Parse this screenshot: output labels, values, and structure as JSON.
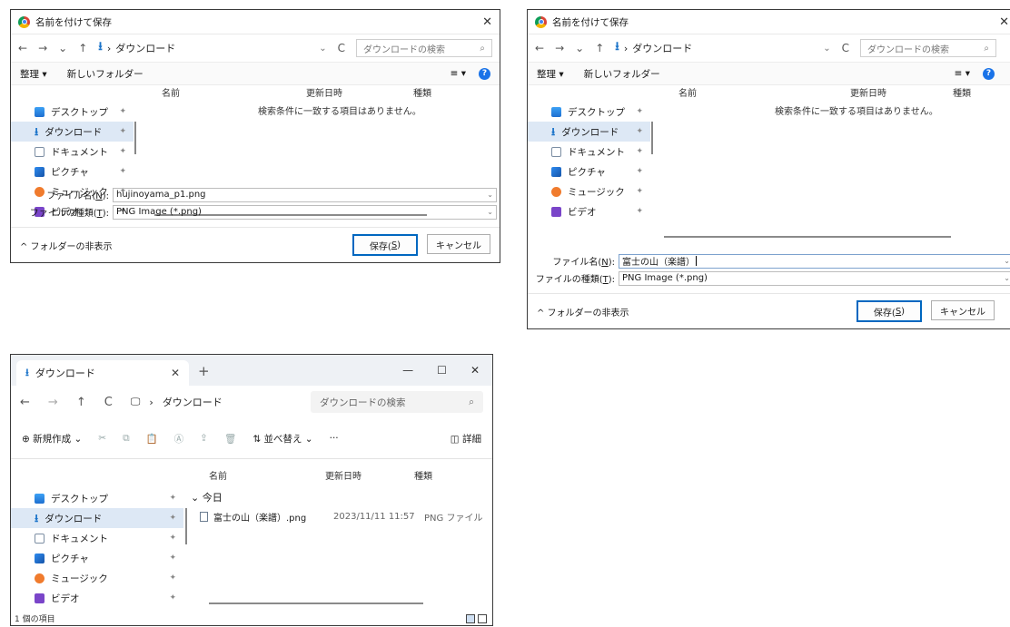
{
  "save_dialog_1": {
    "title": "名前を付けて保存",
    "close": "✕",
    "nav_arrows": [
      "←",
      "→",
      "⌄",
      "↑"
    ],
    "path_icon": "download-arrow",
    "path_sep": "›",
    "path": "ダウンロード",
    "refresh": "C",
    "search_placeholder": "ダウンロードの検索",
    "search_icon": "⌕",
    "organize": "整理 ▾",
    "new_folder": "新しいフォルダー",
    "view_menu": "≡ ▾",
    "help": "?",
    "columns": [
      "名前",
      "更新日時",
      "種類"
    ],
    "empty_message": "検索条件に一致する項目はありません。",
    "sidebar": [
      "デスクトップ",
      "ダウンロード",
      "ドキュメント",
      "ピクチャ",
      "ミュージック",
      "ビデオ"
    ],
    "pin": "📌",
    "filename_label_pre": "ファイル名(",
    "filename_label_key": "N",
    "filename_label_post": "):",
    "filename_value": "hujinoyama_p1.png",
    "filetype_label_pre": "ファイルの種類(",
    "filetype_label_key": "T",
    "filetype_label_post": "):",
    "filetype_value": "PNG Image (*.png)",
    "hide_folders": "^ フォルダーの非表示",
    "save_pre": "保存(",
    "save_key": "S",
    "save_post": ")",
    "cancel": "キャンセル"
  },
  "save_dialog_2": {
    "title": "名前を付けて保存",
    "close": "✕",
    "path": "ダウンロード",
    "search_placeholder": "ダウンロードの検索",
    "organize": "整理 ▾",
    "new_folder": "新しいフォルダー",
    "columns": [
      "名前",
      "更新日時",
      "種類"
    ],
    "empty_message": "検索条件に一致する項目はありません。",
    "sidebar": [
      "デスクトップ",
      "ダウンロード",
      "ドキュメント",
      "ピクチャ",
      "ミュージック",
      "ビデオ"
    ],
    "filename_value": "富士の山（楽譜）",
    "filetype_value": "PNG Image (*.png)",
    "hide_folders": "^ フォルダーの非表示",
    "cancel": "キャンセル"
  },
  "explorer": {
    "tab_title": "ダウンロード",
    "tab_close": "✕",
    "tab_new": "+",
    "min": "—",
    "max": "☐",
    "close": "✕",
    "nav": [
      "←",
      "→",
      "↑",
      "C"
    ],
    "monitor_icon": "🖵",
    "crumb_sep": "›",
    "path": "ダウンロード",
    "search_placeholder": "ダウンロードの検索",
    "search_icon": "⌕",
    "new_label": "⊕ 新規作成 ⌄",
    "cmd_icons": [
      "✂",
      "⧉",
      "📋",
      "Ⓐ",
      "⇪",
      "🗑"
    ],
    "sort_label": "⇅ 並べ替え ⌄",
    "more": "···",
    "details": "◫ 詳細",
    "columns": [
      "名前",
      "更新日時",
      "種類"
    ],
    "group": "⌄ 今日",
    "file_name": "富士の山（楽譜）.png",
    "file_date": "2023/11/11 11:57",
    "file_type": "PNG ファイル",
    "sidebar": [
      "デスクトップ",
      "ダウンロード",
      "ドキュメント",
      "ピクチャ",
      "ミュージック",
      "ビデオ"
    ],
    "status": "1 個の項目"
  }
}
